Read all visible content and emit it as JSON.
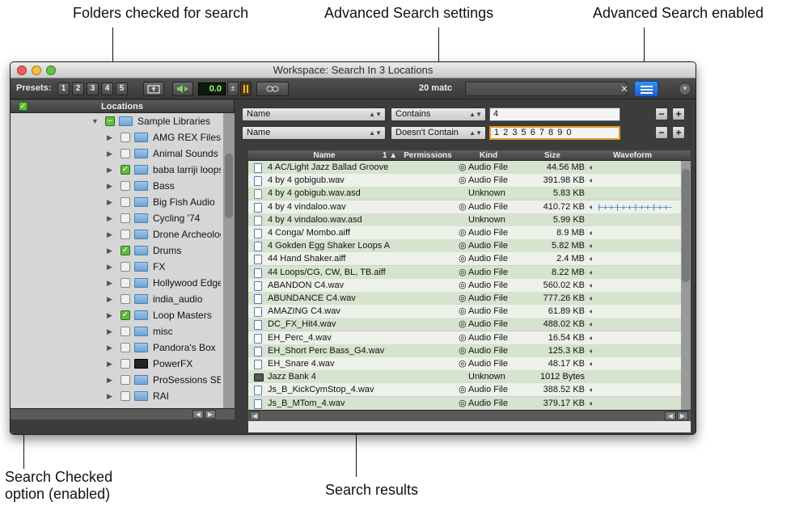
{
  "callouts": {
    "folders_checked": "Folders checked for search",
    "advanced_settings": "Advanced Search settings",
    "advanced_enabled": "Advanced Search enabled",
    "search_checked": "Search Checked option (enabled)",
    "search_results": "Search results"
  },
  "window": {
    "title": "Workspace: Search In 3 Locations"
  },
  "toolbar": {
    "presets_label": "Presets:",
    "preset_buttons": [
      "1",
      "2",
      "3",
      "4",
      "5"
    ],
    "lcd_value": "0.0",
    "items_text": "20 matc",
    "clear_label": "✕"
  },
  "locations": {
    "header": "Locations",
    "items": [
      {
        "label": "Sample Libraries",
        "checked": "partial",
        "level": 0
      },
      {
        "label": "AMG REX Files",
        "checked": false,
        "level": 1
      },
      {
        "label": "Animal Sounds",
        "checked": false,
        "level": 1
      },
      {
        "label": "baba larriji loops",
        "checked": true,
        "level": 1
      },
      {
        "label": "Bass",
        "checked": false,
        "level": 1
      },
      {
        "label": "Big Fish Audio",
        "checked": false,
        "level": 1
      },
      {
        "label": "Cycling '74",
        "checked": false,
        "level": 1
      },
      {
        "label": "Drone Archeology",
        "checked": false,
        "level": 1
      },
      {
        "label": "Drums",
        "checked": true,
        "level": 1
      },
      {
        "label": "FX",
        "checked": false,
        "level": 1
      },
      {
        "label": "Hollywood Edge So",
        "checked": false,
        "level": 1
      },
      {
        "label": "india_audio",
        "checked": false,
        "level": 1
      },
      {
        "label": "Loop Masters",
        "checked": true,
        "level": 1
      },
      {
        "label": "misc",
        "checked": false,
        "level": 1
      },
      {
        "label": "Pandora's Box",
        "checked": false,
        "level": 1
      },
      {
        "label": "PowerFX",
        "checked": false,
        "level": 1
      },
      {
        "label": "ProSessions SE",
        "checked": false,
        "level": 1
      },
      {
        "label": "RAI",
        "checked": false,
        "level": 1
      }
    ]
  },
  "criteria": [
    {
      "field": "Name",
      "operator": "Contains",
      "value": "4"
    },
    {
      "field": "Name",
      "operator": "Doesn't Contain",
      "value": "1 2 3 5 6 7 8 9 0"
    }
  ],
  "results": {
    "columns": {
      "name": "Name",
      "sort": "1 ▲",
      "permissions": "Permissions",
      "kind": "Kind",
      "size": "Size",
      "waveform": "Waveform"
    },
    "rows": [
      {
        "name": "4 AC/Light Jazz Ballad Groove",
        "kind": "◎ Audio File",
        "size": "44.56 MB",
        "icon": "audio"
      },
      {
        "name": "4 by 4 gobigub.wav",
        "kind": "◎ Audio File",
        "size": "391.98 KB",
        "icon": "audio"
      },
      {
        "name": "4 by 4 gobigub.wav.asd",
        "kind": "Unknown",
        "size": "5.83 KB",
        "icon": "doc"
      },
      {
        "name": "4 by 4 vindaloo.wav",
        "kind": "◎ Audio File",
        "size": "410.72 KB",
        "icon": "audio"
      },
      {
        "name": "4 by 4 vindaloo.wav.asd",
        "kind": "Unknown",
        "size": "5.99 KB",
        "icon": "doc"
      },
      {
        "name": "4 Conga/ Mombo.aiff",
        "kind": "◎ Audio File",
        "size": "8.9 MB",
        "icon": "audio"
      },
      {
        "name": "4 Gokden Egg Shaker Loops A",
        "kind": "◎ Audio File",
        "size": "5.82 MB",
        "icon": "audio"
      },
      {
        "name": "44 Hand Shaker.aiff",
        "kind": "◎ Audio File",
        "size": "2.4 MB",
        "icon": "audio"
      },
      {
        "name": "44 Loops/CG, CW, BL, TB.aiff",
        "kind": "◎ Audio File",
        "size": "8.22 MB",
        "icon": "audio"
      },
      {
        "name": "ABANDON C4.wav",
        "kind": "◎ Audio File",
        "size": "560.02 KB",
        "icon": "audio"
      },
      {
        "name": "ABUNDANCE C4.wav",
        "kind": "◎ Audio File",
        "size": "777.26 KB",
        "icon": "audio"
      },
      {
        "name": "AMAZING C4.wav",
        "kind": "◎ Audio File",
        "size": "61.89 KB",
        "icon": "audio"
      },
      {
        "name": "DC_FX_Hit4.wav",
        "kind": "◎ Audio File",
        "size": "488.02 KB",
        "icon": "audio"
      },
      {
        "name": "EH_Perc_4.wav",
        "kind": "◎ Audio File",
        "size": "16.54 KB",
        "icon": "audio"
      },
      {
        "name": "EH_Short Perc Bass_G4.wav",
        "kind": "◎ Audio File",
        "size": "125.3 KB",
        "icon": "audio"
      },
      {
        "name": "EH_Snare 4.wav",
        "kind": "◎ Audio File",
        "size": "48.17 KB",
        "icon": "audio"
      },
      {
        "name": "Jazz Bank 4",
        "kind": "Unknown",
        "size": "1012 Bytes",
        "icon": "bank"
      },
      {
        "name": "Js_B_KickCymStop_4.wav",
        "kind": "◎ Audio File",
        "size": "388.52 KB",
        "icon": "audio"
      },
      {
        "name": "Js_B_MTom_4.wav",
        "kind": "◎ Audio File",
        "size": "379.17 KB",
        "icon": "audio"
      }
    ]
  },
  "colors": {
    "accent_blue": "#2a75de",
    "check_green": "#5fbe3c",
    "focus_orange": "#e39b2c"
  }
}
